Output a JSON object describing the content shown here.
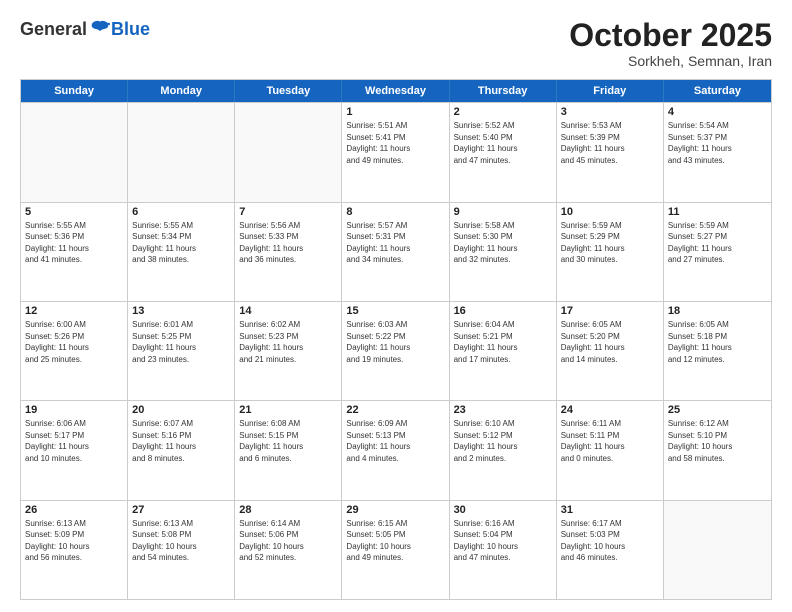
{
  "header": {
    "logo": {
      "general": "General",
      "blue": "Blue"
    },
    "title": "October 2025",
    "subtitle": "Sorkheh, Semnan, Iran"
  },
  "weekdays": [
    "Sunday",
    "Monday",
    "Tuesday",
    "Wednesday",
    "Thursday",
    "Friday",
    "Saturday"
  ],
  "rows": [
    [
      {
        "day": "",
        "info": ""
      },
      {
        "day": "",
        "info": ""
      },
      {
        "day": "",
        "info": ""
      },
      {
        "day": "1",
        "info": "Sunrise: 5:51 AM\nSunset: 5:41 PM\nDaylight: 11 hours\nand 49 minutes."
      },
      {
        "day": "2",
        "info": "Sunrise: 5:52 AM\nSunset: 5:40 PM\nDaylight: 11 hours\nand 47 minutes."
      },
      {
        "day": "3",
        "info": "Sunrise: 5:53 AM\nSunset: 5:39 PM\nDaylight: 11 hours\nand 45 minutes."
      },
      {
        "day": "4",
        "info": "Sunrise: 5:54 AM\nSunset: 5:37 PM\nDaylight: 11 hours\nand 43 minutes."
      }
    ],
    [
      {
        "day": "5",
        "info": "Sunrise: 5:55 AM\nSunset: 5:36 PM\nDaylight: 11 hours\nand 41 minutes."
      },
      {
        "day": "6",
        "info": "Sunrise: 5:55 AM\nSunset: 5:34 PM\nDaylight: 11 hours\nand 38 minutes."
      },
      {
        "day": "7",
        "info": "Sunrise: 5:56 AM\nSunset: 5:33 PM\nDaylight: 11 hours\nand 36 minutes."
      },
      {
        "day": "8",
        "info": "Sunrise: 5:57 AM\nSunset: 5:31 PM\nDaylight: 11 hours\nand 34 minutes."
      },
      {
        "day": "9",
        "info": "Sunrise: 5:58 AM\nSunset: 5:30 PM\nDaylight: 11 hours\nand 32 minutes."
      },
      {
        "day": "10",
        "info": "Sunrise: 5:59 AM\nSunset: 5:29 PM\nDaylight: 11 hours\nand 30 minutes."
      },
      {
        "day": "11",
        "info": "Sunrise: 5:59 AM\nSunset: 5:27 PM\nDaylight: 11 hours\nand 27 minutes."
      }
    ],
    [
      {
        "day": "12",
        "info": "Sunrise: 6:00 AM\nSunset: 5:26 PM\nDaylight: 11 hours\nand 25 minutes."
      },
      {
        "day": "13",
        "info": "Sunrise: 6:01 AM\nSunset: 5:25 PM\nDaylight: 11 hours\nand 23 minutes."
      },
      {
        "day": "14",
        "info": "Sunrise: 6:02 AM\nSunset: 5:23 PM\nDaylight: 11 hours\nand 21 minutes."
      },
      {
        "day": "15",
        "info": "Sunrise: 6:03 AM\nSunset: 5:22 PM\nDaylight: 11 hours\nand 19 minutes."
      },
      {
        "day": "16",
        "info": "Sunrise: 6:04 AM\nSunset: 5:21 PM\nDaylight: 11 hours\nand 17 minutes."
      },
      {
        "day": "17",
        "info": "Sunrise: 6:05 AM\nSunset: 5:20 PM\nDaylight: 11 hours\nand 14 minutes."
      },
      {
        "day": "18",
        "info": "Sunrise: 6:05 AM\nSunset: 5:18 PM\nDaylight: 11 hours\nand 12 minutes."
      }
    ],
    [
      {
        "day": "19",
        "info": "Sunrise: 6:06 AM\nSunset: 5:17 PM\nDaylight: 11 hours\nand 10 minutes."
      },
      {
        "day": "20",
        "info": "Sunrise: 6:07 AM\nSunset: 5:16 PM\nDaylight: 11 hours\nand 8 minutes."
      },
      {
        "day": "21",
        "info": "Sunrise: 6:08 AM\nSunset: 5:15 PM\nDaylight: 11 hours\nand 6 minutes."
      },
      {
        "day": "22",
        "info": "Sunrise: 6:09 AM\nSunset: 5:13 PM\nDaylight: 11 hours\nand 4 minutes."
      },
      {
        "day": "23",
        "info": "Sunrise: 6:10 AM\nSunset: 5:12 PM\nDaylight: 11 hours\nand 2 minutes."
      },
      {
        "day": "24",
        "info": "Sunrise: 6:11 AM\nSunset: 5:11 PM\nDaylight: 11 hours\nand 0 minutes."
      },
      {
        "day": "25",
        "info": "Sunrise: 6:12 AM\nSunset: 5:10 PM\nDaylight: 10 hours\nand 58 minutes."
      }
    ],
    [
      {
        "day": "26",
        "info": "Sunrise: 6:13 AM\nSunset: 5:09 PM\nDaylight: 10 hours\nand 56 minutes."
      },
      {
        "day": "27",
        "info": "Sunrise: 6:13 AM\nSunset: 5:08 PM\nDaylight: 10 hours\nand 54 minutes."
      },
      {
        "day": "28",
        "info": "Sunrise: 6:14 AM\nSunset: 5:06 PM\nDaylight: 10 hours\nand 52 minutes."
      },
      {
        "day": "29",
        "info": "Sunrise: 6:15 AM\nSunset: 5:05 PM\nDaylight: 10 hours\nand 49 minutes."
      },
      {
        "day": "30",
        "info": "Sunrise: 6:16 AM\nSunset: 5:04 PM\nDaylight: 10 hours\nand 47 minutes."
      },
      {
        "day": "31",
        "info": "Sunrise: 6:17 AM\nSunset: 5:03 PM\nDaylight: 10 hours\nand 46 minutes."
      },
      {
        "day": "",
        "info": ""
      }
    ]
  ]
}
